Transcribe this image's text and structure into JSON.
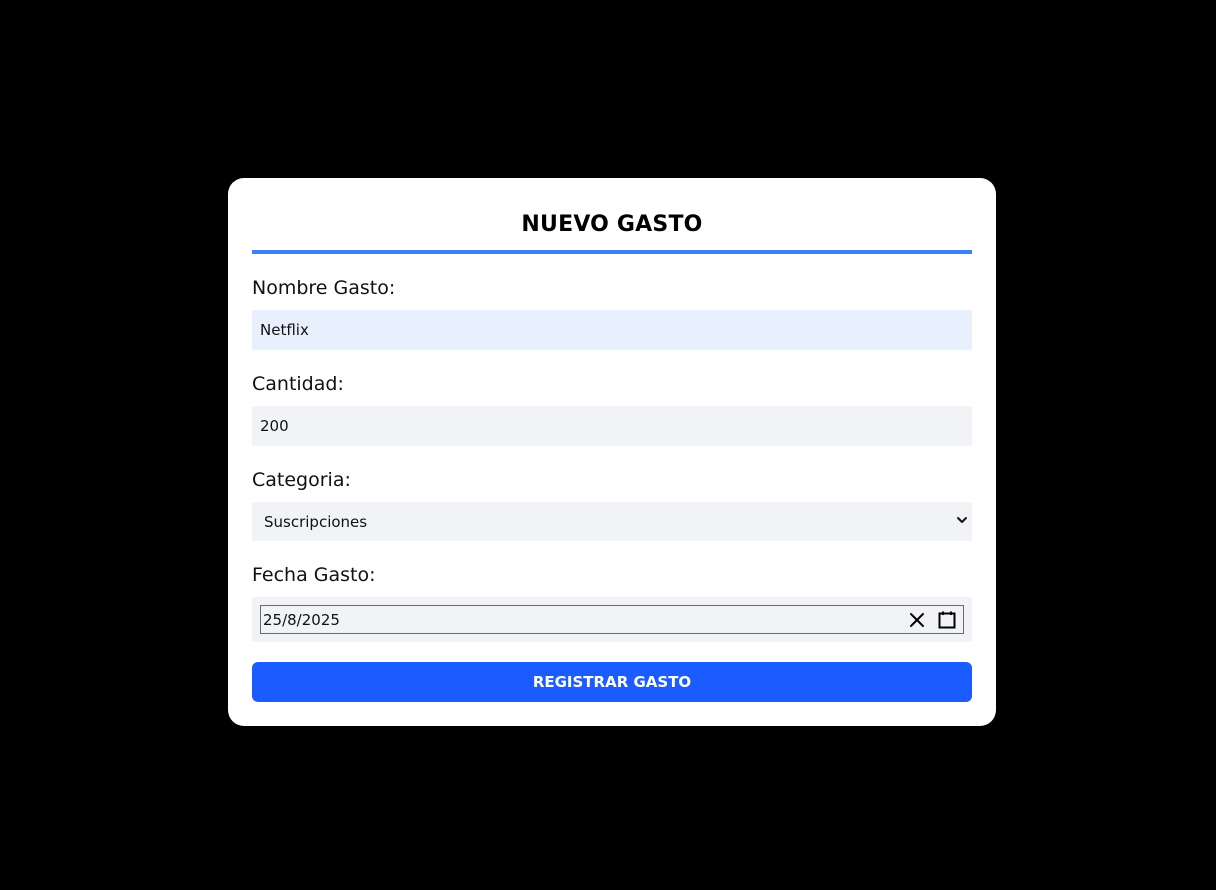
{
  "form": {
    "title": "NUEVO GASTO",
    "accent_color": "#3b82f6",
    "name_label": "Nombre Gasto:",
    "name_value": "Netflix",
    "amount_label": "Cantidad:",
    "amount_value": "200",
    "category_label": "Categoria:",
    "category_selected": "Suscripciones",
    "date_label": "Fecha Gasto:",
    "date_value": "25/8/2025",
    "submit_label": "REGISTRAR GASTO",
    "submit_color": "#1a5cff"
  },
  "icons": {
    "select": "chevron-down-icon",
    "clear": "close-icon",
    "calendar": "calendar-icon"
  }
}
